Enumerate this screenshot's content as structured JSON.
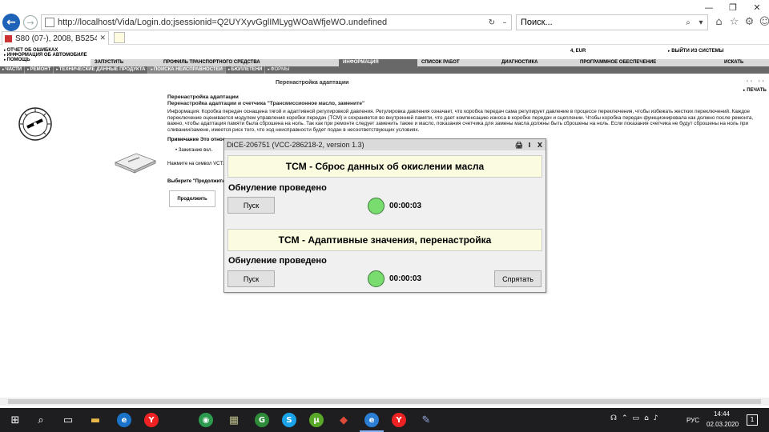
{
  "browser": {
    "url": "http://localhost/Vida/Login.do;jsessionid=Q2UYXyvGglIMLygWOaWfjeWO.undefined",
    "search_placeholder": "Поиск...",
    "tab_title": "S80 (07-), 2008, B5254T6, TF...",
    "window_controls": [
      "—",
      "❐",
      "✕"
    ],
    "toolbar_icons": [
      "home-icon",
      "star-icon",
      "gear-icon",
      "smiley-icon"
    ]
  },
  "vida": {
    "top_links": [
      "ОТЧЕТ ОБ ОШИБКАХ",
      "ИНФОРМАЦИЯ ОБ АВТОМОБИЛЕ",
      "ПОМОЩЬ"
    ],
    "user_info": "4, EUR",
    "logout": "ВЫЙТИ ИЗ СИСТЕМЫ",
    "main_nav": [
      {
        "label": "ЗАПУСТИТЬ",
        "active": false
      },
      {
        "label": "ПРОФИЛЬ ТРАНСПОРТНОГО СРЕДСТВА",
        "active": false
      },
      {
        "label": "ИНФОРМАЦИЯ",
        "active": true
      },
      {
        "label": "СПИСОК РАБОТ",
        "active": false
      },
      {
        "label": "ДИАГНОСТИКА",
        "active": false
      },
      {
        "label": "ПРОГРАММНОЕ ОБЕСПЕЧЕНИЕ",
        "active": false
      },
      {
        "label": "ИСКАТЬ",
        "active": false
      }
    ],
    "sub_nav": [
      {
        "label": "ЧАСТИ",
        "active": false
      },
      {
        "label": "РЕМОНТ",
        "active": false
      },
      {
        "label": "ТЕХНИЧЕСКИЕ ДАННЫЕ ПРОДУКТА",
        "active": false
      },
      {
        "label": "ПОИСКА НЕИСПРАВНОСТЕЙ",
        "active": true
      },
      {
        "label": "БЮЛЛЕТЕНИ",
        "active": false
      },
      {
        "label": "ФОРМЫ",
        "active": false
      }
    ],
    "nav_arrows": "‹‹ ››",
    "print": "ПЕЧАТЬ",
    "page_heading": "Перенастройка адаптации",
    "section_title": "Перенастройка адаптации",
    "section_subtitle": "Перенастройка адаптации и счетчика \"Трансмиссионное масло, замените\"",
    "info_text": "Информация: Коробка передач оснащена тягой и адаптивной регулировкой давления. Регулировка давления означает, что коробка передач сама регулирует давление в процессе переключения, чтобы избежать жестких переключений. Каждое переключение оценивается модулем управления коробки передач (TCM) и сохраняется во внутренней памяти, что дает компенсацию износа в коробке передач и сцеплении. Чтобы коробка передач функционировала как должно после ремонта, важно, чтобы адаптация памяти была сброшена на ноль. Так как при ремонте следует заменить также и масло, показания счетчика для замены масла должны быть сброшены на ноль. Если показания счетчика не будут сброшены на ноль при сливании/замене, имеется риск того, что ход неисправности будет подан в несоответствующих условиях.",
    "note_title": "Примечание Это относ",
    "bullet": "Зажигание вкл.",
    "press_text": "Нажмите на символ VCT2",
    "choose_text": "Выберите \"Продолжить\".",
    "continue_button": "Продолжить"
  },
  "dice": {
    "title": "DiCE-206751   (VCC-286218-2, version 1.3)",
    "title_icons": [
      "🖨",
      "I",
      "X"
    ],
    "section1": {
      "banner": "TCM - Сброс данных об окислении масла",
      "status": "Обнуление проведено",
      "button": "Пуск",
      "time": "00:00:03",
      "led_color": "#79dc6f"
    },
    "section2": {
      "banner": "TCM - Адаптивные значения, перенастройка",
      "status": "Обнуление проведено",
      "button": "Пуск",
      "time": "00:00:03",
      "led_color": "#79dc6f"
    },
    "hide_button": "Спрятать"
  },
  "taskbar": {
    "icons": [
      "windows-start-icon",
      "search-icon",
      "task-view-icon",
      "file-explorer-icon",
      "edge-icon",
      "yandex-icon",
      "chrome-icon",
      "winrar-icon",
      "greenshot-icon",
      "skype-icon",
      "utorrent-icon",
      "anydesk-icon",
      "internet-explorer-icon",
      "yandex-browser-icon",
      "paint-icon"
    ],
    "language": "РУС",
    "time": "14:44",
    "date": "02.03.2020",
    "notifications": "1"
  }
}
